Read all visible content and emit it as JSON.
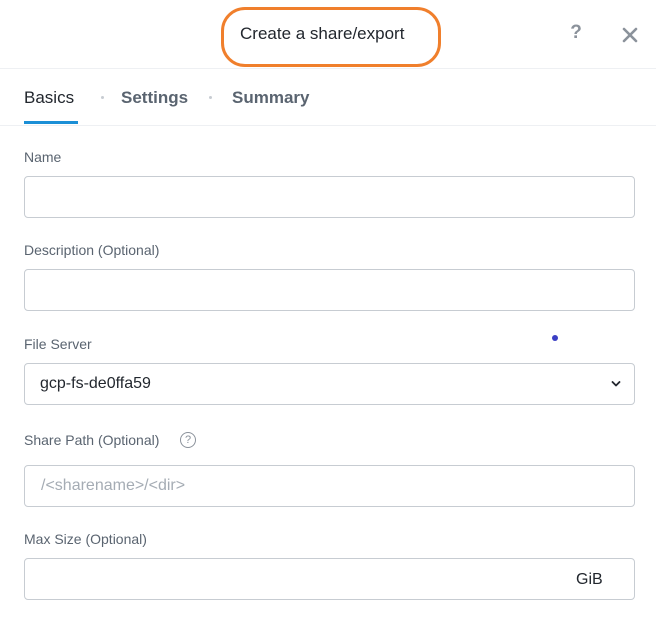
{
  "dialog": {
    "title": "Create a share/export",
    "help_label": "?"
  },
  "tabs": [
    {
      "label": "Basics",
      "active": true
    },
    {
      "label": "Settings",
      "active": false
    },
    {
      "label": "Summary",
      "active": false
    }
  ],
  "form": {
    "name": {
      "label": "Name",
      "value": ""
    },
    "description": {
      "label": "Description (Optional)",
      "value": ""
    },
    "file_server": {
      "label": "File Server",
      "selected": "gcp-fs-de0ffa59"
    },
    "share_path": {
      "label": "Share Path (Optional)",
      "placeholder": "/<sharename>/<dir>",
      "info_icon": "?"
    },
    "max_size": {
      "label": "Max Size (Optional)",
      "value": "",
      "unit": "GiB"
    }
  },
  "colors": {
    "title_highlight": "#f07f2c",
    "active_tab_underline": "#1b8fd6",
    "status_dot": "#3b3fc4"
  }
}
